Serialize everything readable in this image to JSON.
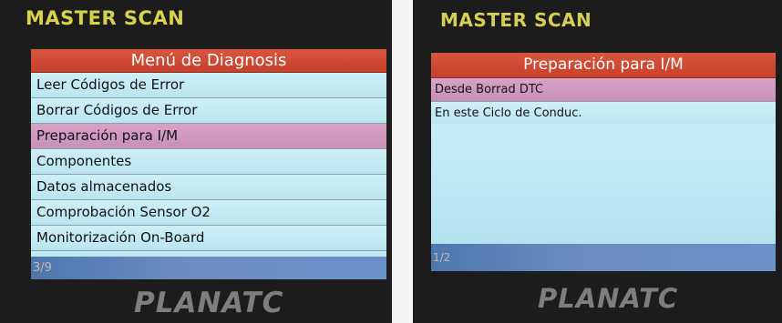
{
  "left_screen": {
    "brand": "MASTER SCAN",
    "title": "Menú de Diagnosis",
    "items": [
      {
        "label": "Leer Códigos de Error"
      },
      {
        "label": "Borrar Códigos de Error"
      },
      {
        "label": "Preparación para I/M"
      },
      {
        "label": "Componentes"
      },
      {
        "label": "Datos almacenados"
      },
      {
        "label": "Comprobación Sensor O2"
      },
      {
        "label": "Monitorización On-Board"
      }
    ],
    "page_indicator": "3/9",
    "logo": "PLANATC"
  },
  "right_screen": {
    "brand": "MASTER SCAN",
    "title": "Preparación para I/M",
    "items": [
      {
        "label": "Desde Borrad DTC"
      },
      {
        "label": "En este Ciclo de Conduc."
      }
    ],
    "page_indicator": "1/2",
    "logo": "PLANATC"
  },
  "colors": {
    "titlebar": "#c9442f",
    "selected_row": "#d19bc0",
    "row": "#c3eaf4",
    "statusbar": "#5b82b8",
    "brand": "#d9d24a"
  }
}
